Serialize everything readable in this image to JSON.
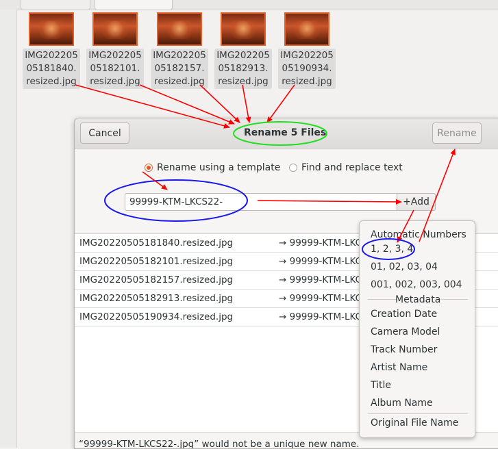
{
  "files": [
    {
      "name": "IMG202205\n05181840.\nresized.jpg"
    },
    {
      "name": "IMG202205\n05182101.\nresized.jpg"
    },
    {
      "name": "IMG202205\n05182157.\nresized.jpg"
    },
    {
      "name": "IMG202205\n05182913.\nresized.jpg"
    },
    {
      "name": "IMG202205\n05190934.\nresized.jpg"
    }
  ],
  "dialog": {
    "title": "Rename 5 Files",
    "cancel_label": "Cancel",
    "rename_label": "Rename",
    "mode_template_label": "Rename using a template",
    "mode_replace_label": "Find and replace text",
    "template_value": "99999-KTM-LKCS22-",
    "add_label": "+Add",
    "rows": [
      {
        "old": "IMG20220505181840.resized.jpg",
        "new": "→ 99999-KTM-LKC"
      },
      {
        "old": "IMG20220505182101.resized.jpg",
        "new": "→ 99999-KTM-LKC"
      },
      {
        "old": "IMG20220505182157.resized.jpg",
        "new": "→ 99999-KTM-LKC"
      },
      {
        "old": "IMG20220505182913.resized.jpg",
        "new": "→ 99999-KTM-LKC"
      },
      {
        "old": "IMG20220505190934.resized.jpg",
        "new": "→ 99999-KTM-LKC"
      }
    ],
    "status_text": "“99999-KTM-LKCS22-.jpg” would not be a unique new name."
  },
  "popover": {
    "auto_numbers_header": "Automatic Numbers",
    "number_formats": [
      "1, 2, 3, 4",
      "01, 02, 03, 04",
      "001, 002, 003, 004"
    ],
    "metadata_header": "Metadata",
    "metadata_items": [
      "Creation Date",
      "Camera Model",
      "Track Number",
      "Artist Name",
      "Title",
      "Album Name"
    ],
    "original_name_label": "Original File Name"
  },
  "colors": {
    "accent": "#e95420",
    "annotation_red": "#ff0000",
    "annotation_blue": "#0000ff",
    "annotation_green": "#22dd22"
  },
  "icons": {
    "radio_selected": "radio-selected-icon",
    "radio_unselected": "radio-unselected-icon"
  }
}
